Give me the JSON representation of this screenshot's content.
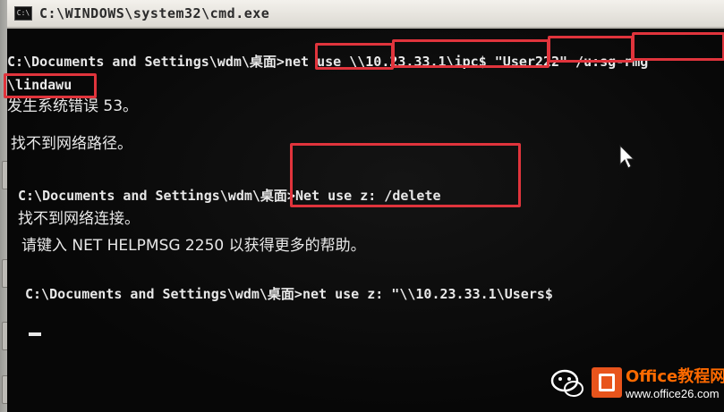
{
  "window": {
    "title": "C:\\WINDOWS\\system32\\cmd.exe",
    "icon": "cmd-window-icon",
    "icon_text": "C:\\"
  },
  "console": {
    "lines": [
      "C:\\Documents and Settings\\wdm\\桌面>net use \\\\10.23.33.1\\ipc$ \"User222\" /u:sg-rmg",
      "\\lindawu",
      "发生系统错误 53。",
      "找不到网络路径。",
      "C:\\Documents and Settings\\wdm\\桌面>Net use z: /delete",
      "找不到网络连接。",
      "请键入 NET HELPMSG 2250 以获得更多的帮助。",
      "C:\\Documents and Settings\\wdm\\桌面>net use z: \"\\\\10.23.33.1\\Users$"
    ]
  },
  "annotations": {
    "color": "#e0343c"
  },
  "watermark": {
    "title": "Office教程网",
    "url": "www.office26.com",
    "logo": "office-logo-icon",
    "chat": "wechat-icon",
    "accent": "#ff6a00"
  }
}
